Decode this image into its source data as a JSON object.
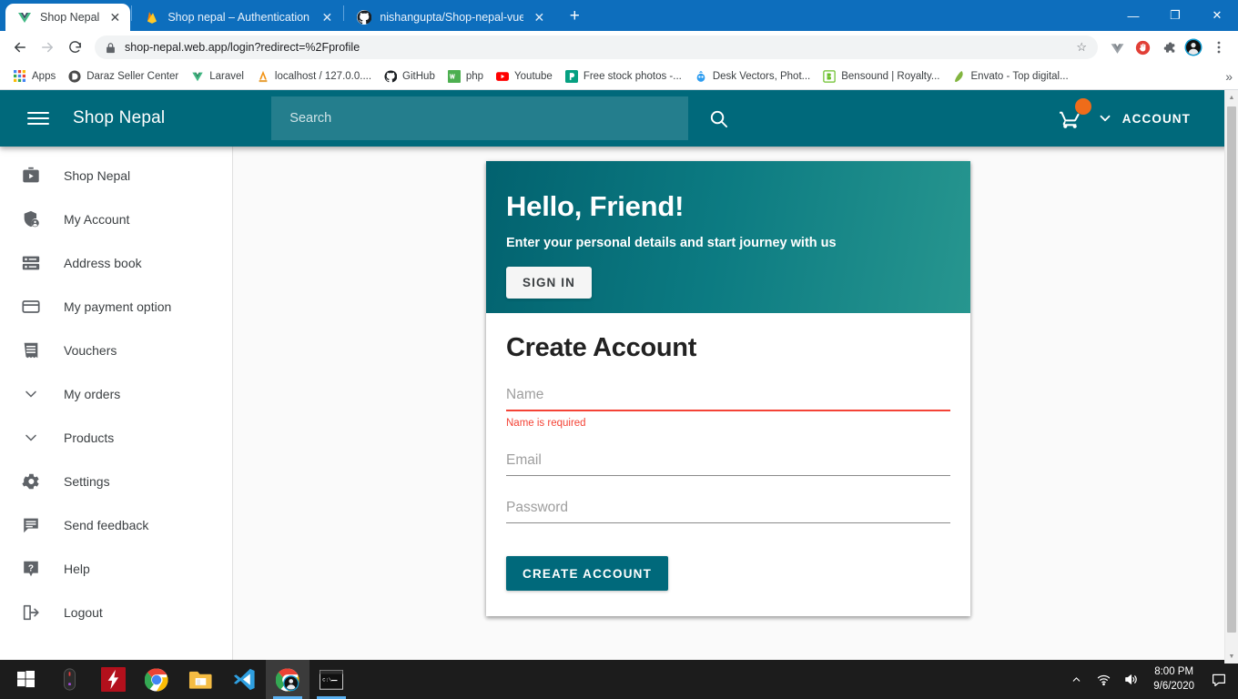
{
  "browser": {
    "tabs": [
      {
        "title": "Shop Nepal",
        "favicon": "vue-icon",
        "active": true
      },
      {
        "title": "Shop nepal – Authentication – Fi",
        "favicon": "firebase-icon",
        "active": false
      },
      {
        "title": "nishangupta/Shop-nepal-vuex-fi",
        "favicon": "github-icon",
        "active": false
      }
    ],
    "new_tab_label": "+",
    "window_controls": {
      "minimize": "—",
      "maximize": "❐",
      "close": "✕"
    },
    "nav": {
      "back": "←",
      "forward": "→",
      "reload": "⟳"
    },
    "omnibox": {
      "url": "shop-nepal.web.app/login?redirect=%2Fprofile",
      "lock_icon": "lock-icon",
      "star_icon": "star-icon"
    },
    "extensions": [
      "vue-devtools-icon",
      "adblock-icon",
      "puzzle-extensions-icon",
      "profile-avatar-icon",
      "chrome-menu-icon"
    ],
    "bookmarks": [
      {
        "label": "Apps",
        "icon": "apps-grid-icon"
      },
      {
        "label": "Daraz Seller Center",
        "icon": "daraz-icon"
      },
      {
        "label": "Laravel",
        "icon": "laravel-icon"
      },
      {
        "label": "localhost / 127.0.0....",
        "icon": "phpmyadmin-icon"
      },
      {
        "label": "GitHub",
        "icon": "github-icon"
      },
      {
        "label": "php",
        "icon": "w3schools-icon"
      },
      {
        "label": "Youtube",
        "icon": "youtube-icon"
      },
      {
        "label": "Free stock photos -...",
        "icon": "pexels-icon"
      },
      {
        "label": "Desk Vectors, Phot...",
        "icon": "freepik-icon"
      },
      {
        "label": "Bensound | Royalty...",
        "icon": "bensound-icon"
      },
      {
        "label": "Envato - Top digital...",
        "icon": "envato-icon"
      }
    ],
    "bookmarks_overflow": "»"
  },
  "app": {
    "brand": "Shop Nepal",
    "menu_icon": "hamburger-menu-icon",
    "search": {
      "placeholder": "Search",
      "value": "",
      "button_icon": "search-icon"
    },
    "cart": {
      "icon": "shopping-cart-icon",
      "badge_color": "#ef6c1a"
    },
    "account": {
      "label": "ACCOUNT",
      "chevron": "chevron-down-icon"
    },
    "accent_color": "#00697b"
  },
  "sidebar": {
    "items": [
      {
        "label": "Shop Nepal",
        "icon": "store-icon"
      },
      {
        "label": "My Account",
        "icon": "account-shield-icon"
      },
      {
        "label": "Address book",
        "icon": "address-book-icon"
      },
      {
        "label": "My payment option",
        "icon": "credit-card-icon"
      },
      {
        "label": "Vouchers",
        "icon": "voucher-icon"
      },
      {
        "label": "My orders",
        "icon": "chevron-down-icon"
      },
      {
        "label": "Products",
        "icon": "chevron-down-icon"
      },
      {
        "label": "Settings",
        "icon": "gear-icon"
      },
      {
        "label": "Send feedback",
        "icon": "feedback-icon"
      },
      {
        "label": "Help",
        "icon": "help-icon"
      },
      {
        "label": "Logout",
        "icon": "logout-icon"
      }
    ]
  },
  "card": {
    "hero": {
      "title": "Hello, Friend!",
      "subtitle": "Enter your personal details and start journey with us",
      "sign_in_label": "SIGN IN"
    },
    "form": {
      "title": "Create Account",
      "fields": [
        {
          "placeholder": "Name",
          "value": "",
          "error": "Name is required",
          "has_error": true
        },
        {
          "placeholder": "Email",
          "value": "",
          "error": "",
          "has_error": false
        },
        {
          "placeholder": "Password",
          "value": "",
          "error": "",
          "has_error": false
        }
      ],
      "submit_label": "CREATE ACCOUNT",
      "error_color": "#f44336"
    }
  },
  "taskbar": {
    "items": [
      {
        "name": "start-button",
        "icon": "windows-logo-icon"
      },
      {
        "name": "mouse-software",
        "icon": "mouse-icon"
      },
      {
        "name": "antivirus",
        "icon": "lightning-bolt-icon"
      },
      {
        "name": "chrome",
        "icon": "chrome-icon"
      },
      {
        "name": "file-explorer",
        "icon": "folder-icon"
      },
      {
        "name": "vscode",
        "icon": "vscode-icon"
      },
      {
        "name": "chrome-active",
        "icon": "chrome-icon"
      },
      {
        "name": "terminal",
        "icon": "terminal-icon"
      }
    ],
    "tray": {
      "chevron": "^",
      "wifi": "wifi-icon",
      "volume": "speaker-icon",
      "notifications": "notification-icon"
    },
    "clock": {
      "time": "8:00 PM",
      "date": "9/6/2020"
    }
  }
}
